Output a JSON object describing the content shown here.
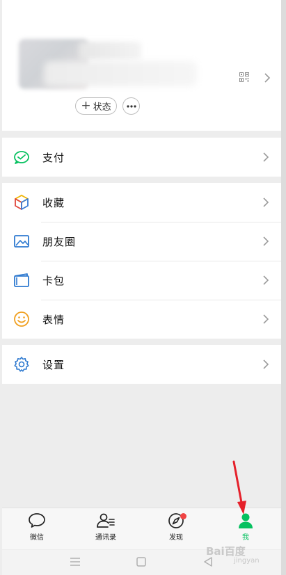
{
  "profile": {
    "status_label": "状态",
    "status_plus": "+",
    "more_label": "•••"
  },
  "menu": {
    "pay": "支付",
    "favorites": "收藏",
    "moments": "朋友圈",
    "cards": "卡包",
    "stickers": "表情",
    "settings": "设置"
  },
  "tabs": [
    {
      "label": "微信",
      "icon": "chat-bubble-icon"
    },
    {
      "label": "通讯录",
      "icon": "contacts-icon"
    },
    {
      "label": "发现",
      "icon": "compass-icon",
      "badge": true
    },
    {
      "label": "我",
      "icon": "person-icon",
      "active": true
    }
  ],
  "colors": {
    "accent": "#07c160",
    "badge": "#f04444",
    "arrow": "#e5202a"
  },
  "watermark": {
    "text": "Bai百度",
    "sub": "jingyan"
  }
}
